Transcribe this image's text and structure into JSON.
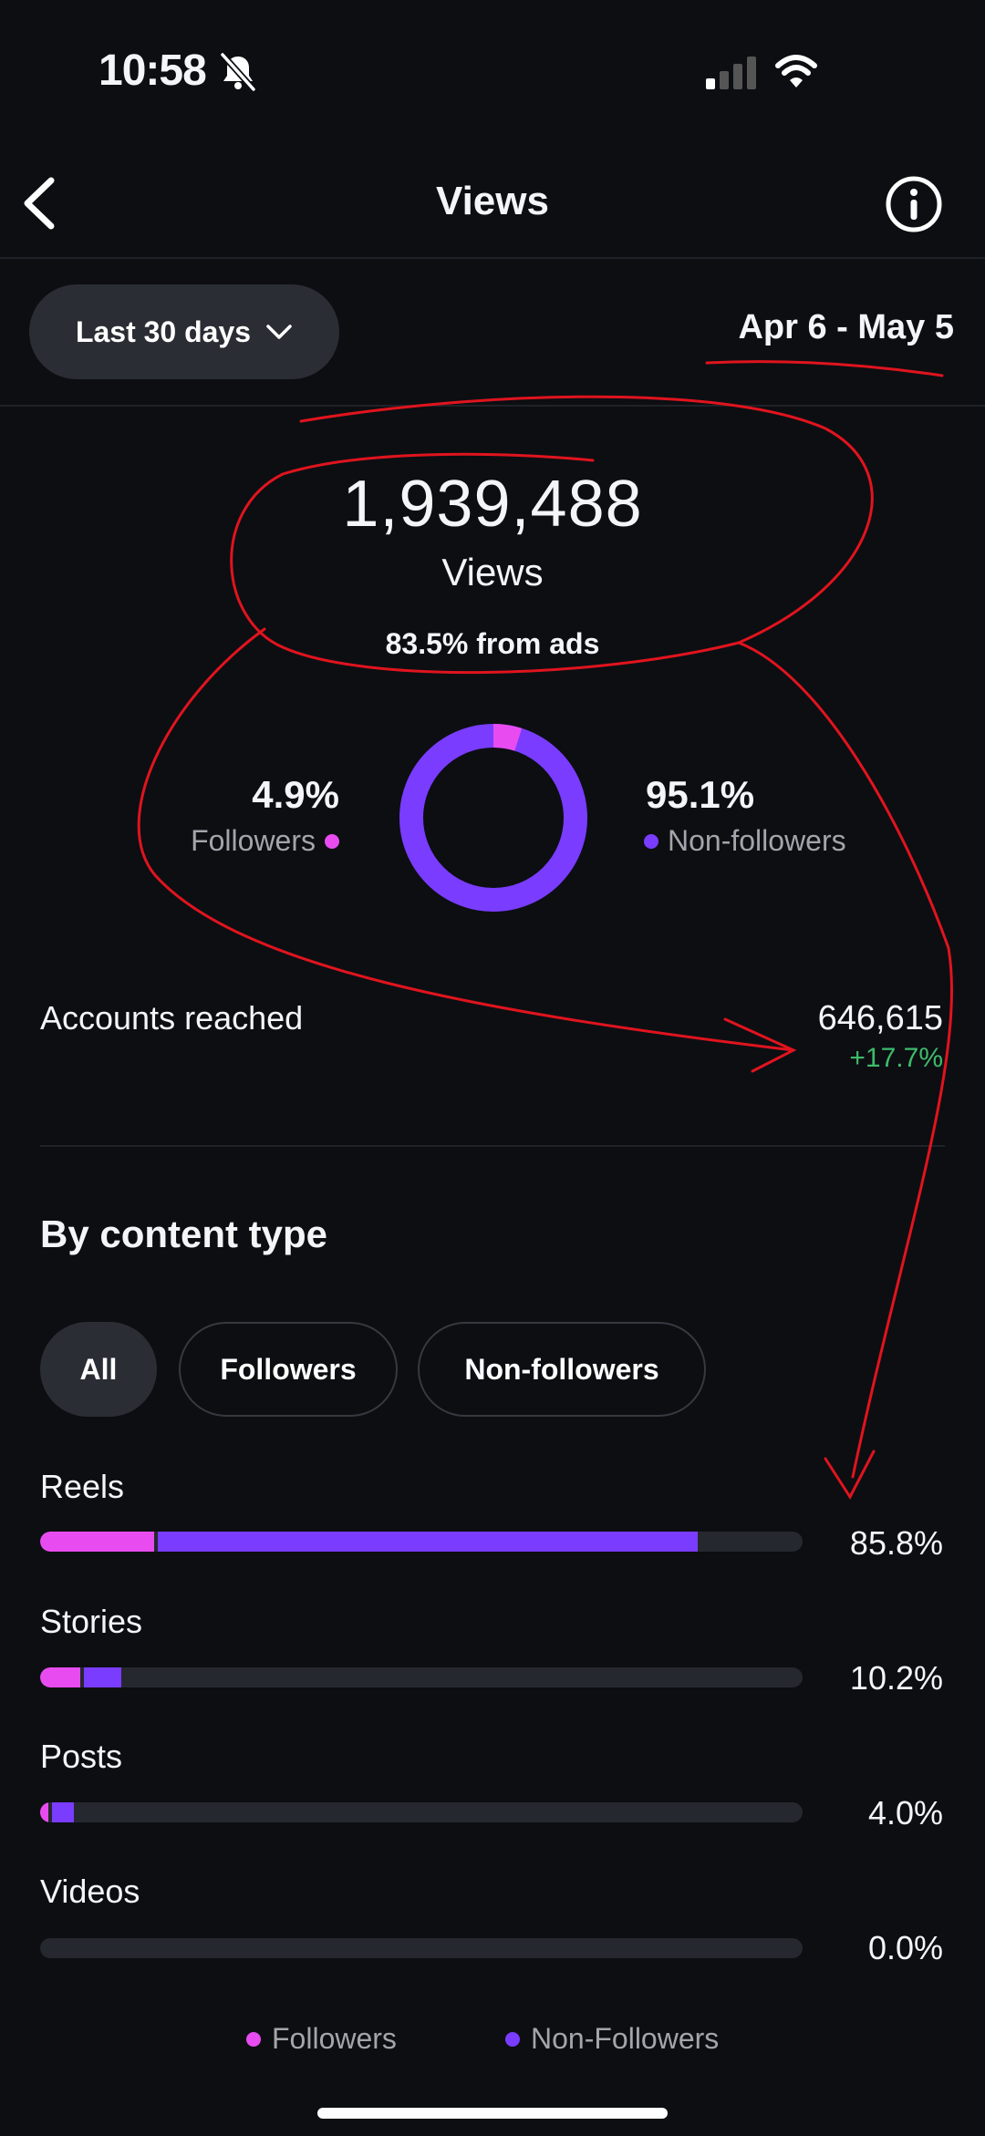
{
  "status": {
    "time": "10:58"
  },
  "nav": {
    "title": "Views"
  },
  "filter": {
    "range_label": "Last 30 days",
    "date_range": "Apr 6 - May 5"
  },
  "metric": {
    "value": "1,939,488",
    "label": "Views",
    "ads_note": "83.5% from ads"
  },
  "split": {
    "followers_pct": "4.9%",
    "followers_label": "Followers",
    "followers_fraction": 0.049,
    "nonfollowers_pct": "95.1%",
    "nonfollowers_label": "Non-followers",
    "nonfollowers_fraction": 0.951
  },
  "accounts": {
    "label": "Accounts reached",
    "value": "646,615",
    "delta": "+17.7%"
  },
  "content_type": {
    "title": "By content type",
    "chips": [
      "All",
      "Followers",
      "Non-followers"
    ],
    "rows": [
      {
        "label": "Reels",
        "pct": "85.8%",
        "followers": 0.15,
        "nonfollowers": 0.708
      },
      {
        "label": "Stories",
        "pct": "10.2%",
        "followers": 0.053,
        "nonfollowers": 0.049
      },
      {
        "label": "Posts",
        "pct": "4.0%",
        "followers": 0.011,
        "nonfollowers": 0.029
      },
      {
        "label": "Videos",
        "pct": "0.0%",
        "followers": 0,
        "nonfollowers": 0
      }
    ],
    "legend": [
      "Followers",
      "Non-Followers"
    ]
  },
  "colors": {
    "followers": "#e84cf0",
    "nonfollowers": "#7a3cff",
    "positive": "#3dbb6a",
    "annotation": "#e0141e"
  },
  "icons": [
    "bell-slash-icon",
    "signal-icon",
    "wifi-icon",
    "back-chevron-icon",
    "info-icon",
    "chevron-down-icon"
  ]
}
